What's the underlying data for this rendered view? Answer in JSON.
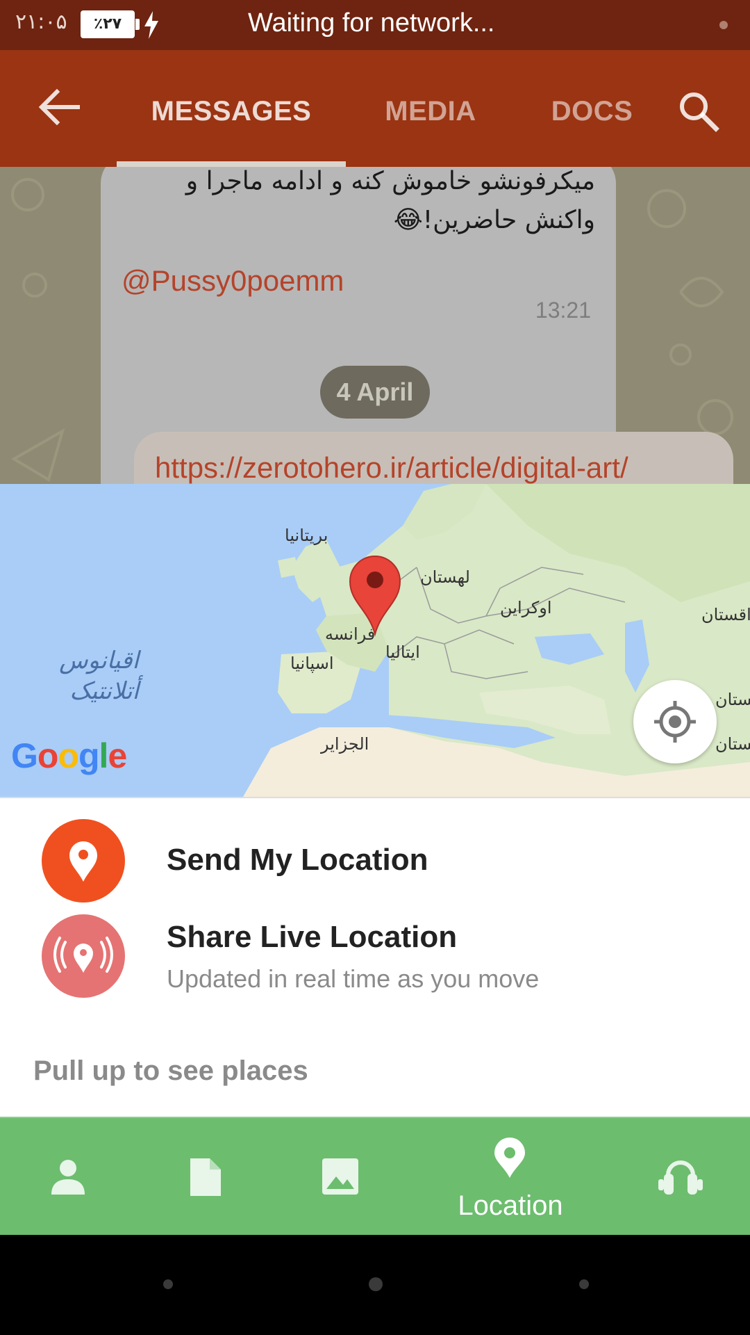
{
  "status_bar": {
    "time": "۲۱:۰۵",
    "battery": "٪۲۷",
    "network_status": "Waiting for network..."
  },
  "header": {
    "tabs": [
      {
        "label": "MESSAGES",
        "active": true
      },
      {
        "label": "MEDIA",
        "active": false
      },
      {
        "label": "DOCS",
        "active": false
      }
    ],
    "icons": [
      "back-arrow-icon",
      "search-icon"
    ]
  },
  "chat": {
    "incoming_message": {
      "line1": "میکرفونشو خاموش کنه و ادامه ماجرا و",
      "line2": "واکنش حاضرین!😂",
      "mention": "@Pussy0poemm",
      "time": "13:21"
    },
    "date_chip": "4 April",
    "outgoing_message": {
      "link": "https://zerotohero.ir/article/digital-art/"
    }
  },
  "map": {
    "labels": {
      "britain": "بریتانیا",
      "poland": "لهستان",
      "ukraine": "اوکراین",
      "france": "فرانسه",
      "italy": "ایتالیا",
      "spain": "اسپانیا",
      "algeria": "الجزایر",
      "kazakhstan": "قزاقستان",
      "right_edge_1": "انستان",
      "right_edge_2": "نستان"
    },
    "ocean_line1": "اقیانوس",
    "ocean_line2": "أتلانتیک",
    "logo_letters": [
      "G",
      "o",
      "o",
      "g",
      "l",
      "e"
    ]
  },
  "sheet": {
    "send_location": "Send My Location",
    "share_live": "Share Live Location",
    "share_live_subtitle": "Updated in real time as you move",
    "pull_hint": "Pull up to see places"
  },
  "attach_bar": {
    "items": [
      {
        "icon": "contact-icon",
        "label": ""
      },
      {
        "icon": "file-icon",
        "label": ""
      },
      {
        "icon": "gallery-icon",
        "label": ""
      },
      {
        "icon": "location-pin-icon",
        "label": "Location",
        "active": true
      },
      {
        "icon": "music-icon",
        "label": ""
      }
    ]
  },
  "colors": {
    "status_bar": "#6e2410",
    "header": "#9a3412",
    "send_icon": "#f0501f",
    "live_icon": "#e57373",
    "attach_bar": "#6cbd6e",
    "link": "#b5432a"
  }
}
